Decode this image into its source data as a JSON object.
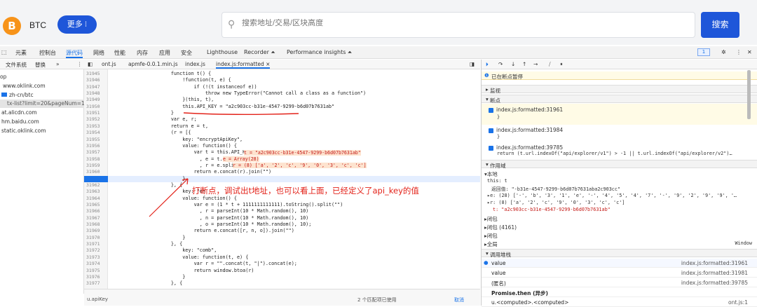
{
  "site": {
    "logo_symbol": "B",
    "name": "BTC",
    "more_button": "更多 ⁝",
    "search_placeholder": "搜索地址/交易/区块高度",
    "search_button": "搜索",
    "brand_color": "#1e56d9",
    "btc_color": "#f7931a"
  },
  "devtools": {
    "tabs": [
      "元素",
      "控制台",
      "源代码",
      "网络",
      "性能",
      "内存",
      "应用",
      "安全",
      "Lighthouse",
      "Recorder ⏶",
      "Performance insights ⏶"
    ],
    "active_tab": "源代码",
    "issues_count": "1",
    "nav_tabs": [
      "文件系统",
      "替换",
      "»"
    ],
    "file_tabs": [
      "ont.js",
      "apmfe-0.0.1.min.js",
      "index.js",
      "index.js:formatted ×"
    ],
    "tree": [
      "op",
      "www.oklink.com",
      "zh-cn/btc",
      "tx-list?limit=20&pageNum=1",
      "at.alicdn.com",
      "hm.baidu.com",
      "static.oklink.com"
    ]
  },
  "code": {
    "line_numbers": [
      "31945",
      "31946",
      "31947",
      "31948",
      "31949",
      "31950",
      "31951",
      "31952",
      "31953",
      "31954",
      "31955",
      "31956",
      "31957",
      "31958",
      "31959",
      "31960",
      "31961",
      "31962",
      "31963",
      "31964",
      "31965",
      "31966",
      "31967",
      "31968",
      "31969",
      "31970",
      "31971",
      "31972",
      "31973",
      "31974",
      "31975",
      "31976",
      "31977"
    ],
    "current_line": "31961",
    "lines": [
      "                    function t() {",
      "                        !function(t, e) {",
      "                            if (!(t instanceof e))",
      "                                throw new TypeError(\"Cannot call a class as a function\")",
      "                        }(this, t),",
      "                        this.API_KEY = \"a2c903cc-b31e-4547-9299-b6d07b7631ab\"",
      "                    }",
      "                    var e, r;",
      "                    return e = t,",
      "                    (r = [{",
      "                        key: \"encryptApiKey\",",
      "                        value: function() {",
      "                            var t = this.API_KEY",
      "                              , e = t.split(\"\")",
      "                              , r = e.splice(0, 8);",
      "                            return e.concat(r).join(\"\")",
      "                        }",
      "                    }, {",
      "                        key: \"en",
      "                        value: function() {",
      "                            var e = (1 * t + 1111111111111).toString().split(\"\")",
      "                              , r = parseInt(10 * Math.random(), 10)",
      "                              , n = parseInt(10 * Math.random(), 10)",
      "                              , o = parseInt(10 * Math.random(), 10);",
      "                            return e.concat([r, n, o]).join(\"\")",
      "                        }",
      "                    }, {",
      "                        key: \"comb\",",
      "                        value: function(t, e) {",
      "                            var r = \"\".concat(t, \"|\").concat(e);",
      "                            return window.btoa(r)",
      "                        }",
      "                    }, {"
    ],
    "inline_values": {
      "t": "t = \"a2c903cc-b31e-4547-9299-b6d07b7631ab\"",
      "e": "e = Array(28)",
      "r": "r = (8) ['a', '2', 'c', '9', '0', '3', 'c', 'c']"
    },
    "annotation": "打断点，调试出t地址，也可以看上面，已经定义了api_key的值",
    "footer_left": "u.apiKey",
    "footer_mid": "2 个匹配项已使用",
    "footer_right": "取消"
  },
  "debugger": {
    "paused_text": "已在断点暂停",
    "sections": {
      "watch": "监视",
      "breakpoints": "断点",
      "scope": "作用域",
      "local": "本地",
      "callstack": "调用堆栈"
    },
    "breakpoints": [
      {
        "file": "index.js:formatted:31961",
        "code": "}"
      },
      {
        "file": "index.js:formatted:31984",
        "code": "}"
      },
      {
        "file": "index.js:formatted:39785",
        "code": "return (t.url.indexOf(\"api/explorer/v1\") > -1 || t.url.indexOf(\"api/explorer/v2\")…"
      }
    ],
    "scope_lines": [
      "this: t",
      "返回值: \"-b31e-4547-9299-b6d07b7631aba2c903cc\"",
      "▸e: (28) ['-', 'b', '3', '1', 'e', '-', '4', '5', '4', '7', '-', '9', '2', '9', '9', '…",
      "▸r: (8) ['a', '2', 'c', '9', '0', '3', 'c', 'c']",
      "t: \"a2c903cc-b31e-4547-9299-b6d07b7631ab\""
    ],
    "closures": [
      "闭包",
      "闭包 (4161)",
      "闭包",
      "全局"
    ],
    "global_value": "Window",
    "stack": [
      {
        "fn": "value",
        "loc": "index.js:formatted:31961"
      },
      {
        "fn": "value",
        "loc": "index.js:formatted:31981"
      },
      {
        "fn": "(匿名)",
        "loc": "index.js:formatted:39785"
      },
      {
        "fn": "Promise.then (异步)",
        "loc": ""
      },
      {
        "fn": "u.<computed>.<computed>",
        "loc": "ont.js:1"
      }
    ]
  }
}
